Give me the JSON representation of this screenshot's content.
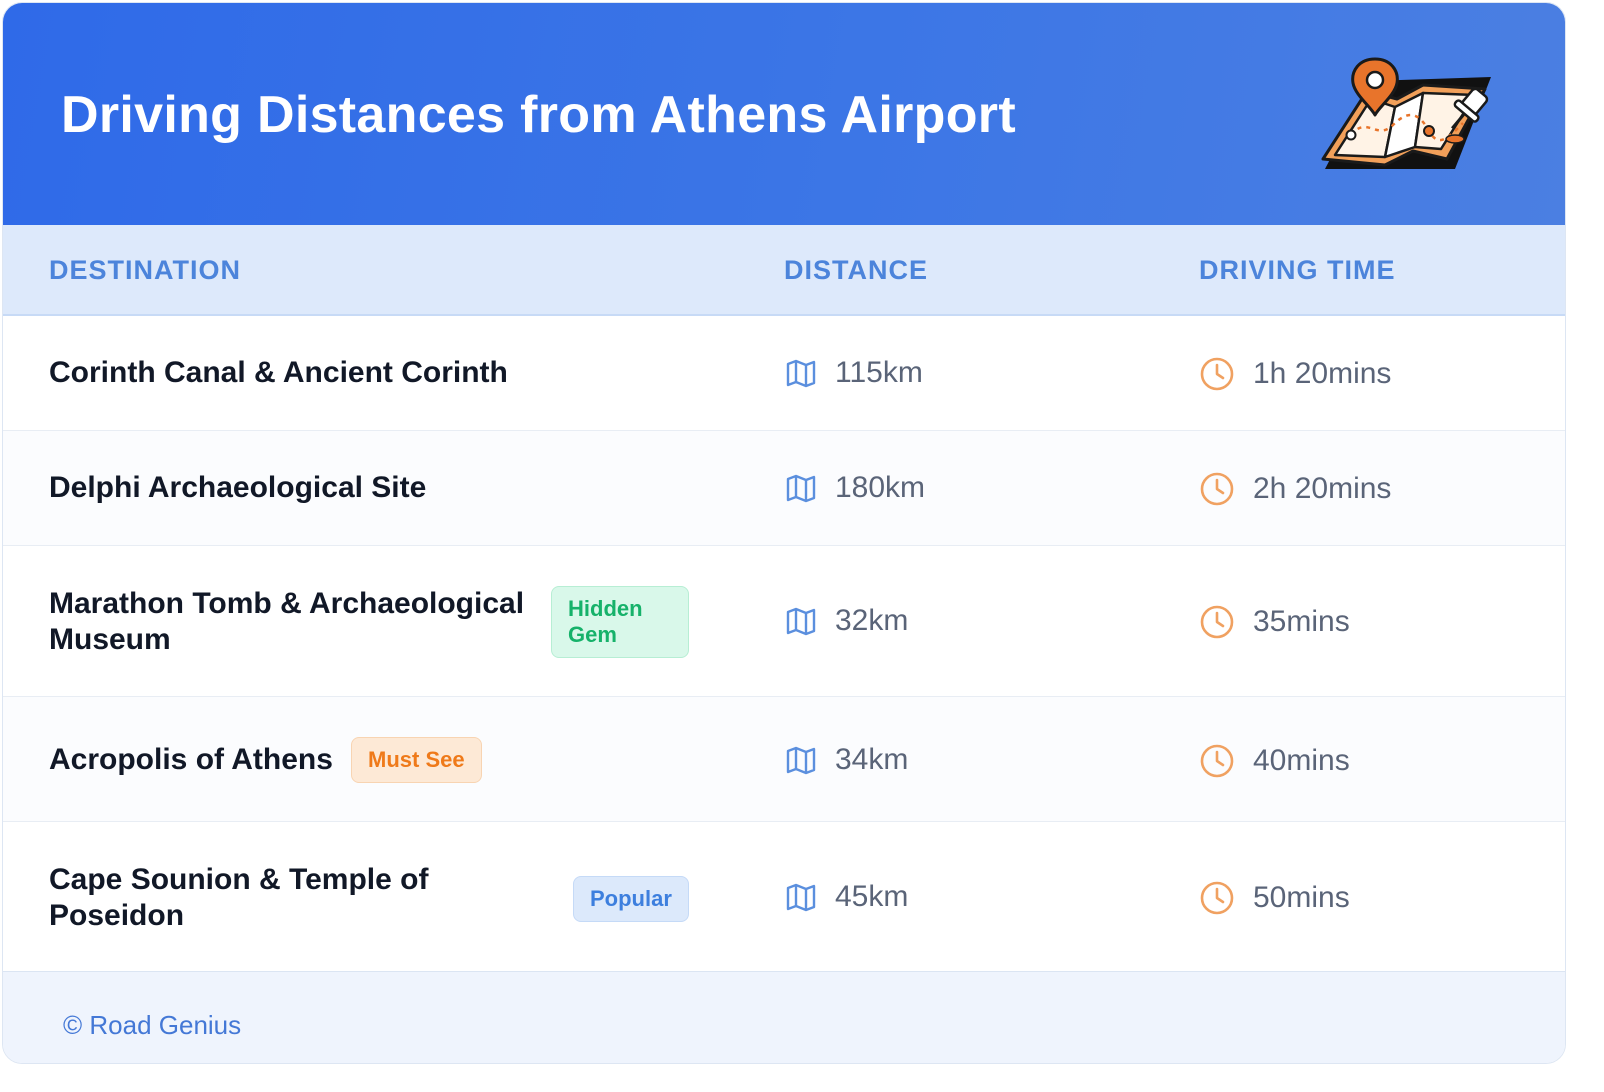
{
  "header": {
    "title": "Driving Distances from Athens Airport",
    "illustration": "map-pin-icon"
  },
  "table": {
    "columns": [
      "DESTINATION",
      "DISTANCE",
      "DRIVING TIME"
    ],
    "rows": [
      {
        "destination": "Corinth Canal & Ancient Corinth",
        "badge": "",
        "distance": "115km",
        "time": "1h 20mins"
      },
      {
        "destination": "Delphi Archaeological Site",
        "badge": "",
        "distance": "180km",
        "time": "2h 20mins"
      },
      {
        "destination": "Marathon Tomb & Archaeological Museum",
        "badge": "Hidden Gem",
        "distance": "32km",
        "time": "35mins"
      },
      {
        "destination": "Acropolis of Athens",
        "badge": "Must See",
        "distance": "34km",
        "time": "40mins"
      },
      {
        "destination": "Cape Sounion & Temple of Poseidon",
        "badge": "Popular",
        "distance": "45km",
        "time": "50mins"
      }
    ]
  },
  "icons": {
    "distance": "map-icon",
    "time": "clock-icon"
  },
  "colors": {
    "header_bg": "#3470e8",
    "header_row_bg": "#dde9fb",
    "column_header_text": "#4c84db",
    "map_icon": "#5b8fde",
    "clock_icon": "#f0a161",
    "badge_hidden_gem": "#16b26a",
    "badge_must_see": "#ef7a1a",
    "badge_popular": "#3d7fde"
  },
  "footer": {
    "text": "© Road Genius"
  }
}
